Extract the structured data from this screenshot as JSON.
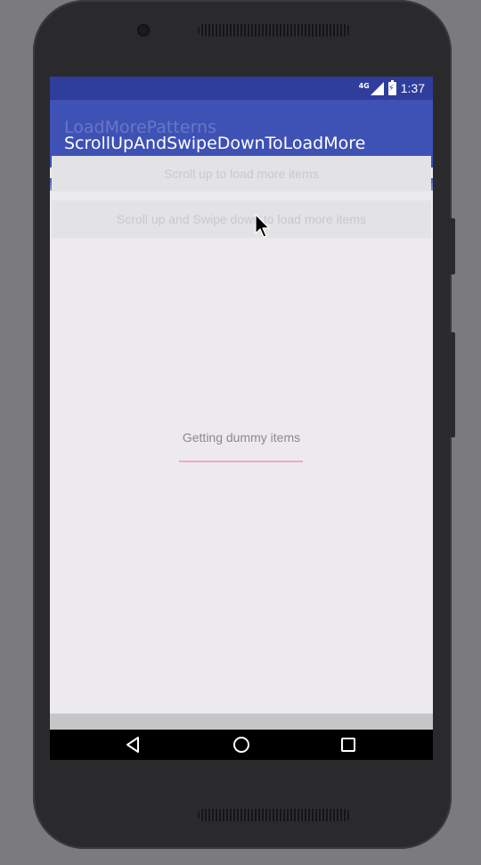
{
  "colors": {
    "status_bar": "#2f3d9c",
    "app_bar": "#3e51b5",
    "screen_bg": "#eceaed",
    "progress": "#f2a8c3"
  },
  "status_bar": {
    "network": "4G",
    "time": "1:37",
    "icons": [
      "signal-icon",
      "battery-charging-icon"
    ]
  },
  "toolbar": {
    "previous_title": "LoadMorePatterns",
    "title": "ScrollUpAndSwipeDownToLoadMore"
  },
  "list": {
    "items": [
      {
        "label": "Scroll up to load more items"
      },
      {
        "label": "Scroll up and Swipe down to load more items"
      }
    ]
  },
  "loading": {
    "message": "Getting dummy items",
    "progress_fraction": 1.0
  },
  "nav_bar": {
    "icons": [
      "back-icon",
      "home-icon",
      "recents-icon"
    ]
  }
}
